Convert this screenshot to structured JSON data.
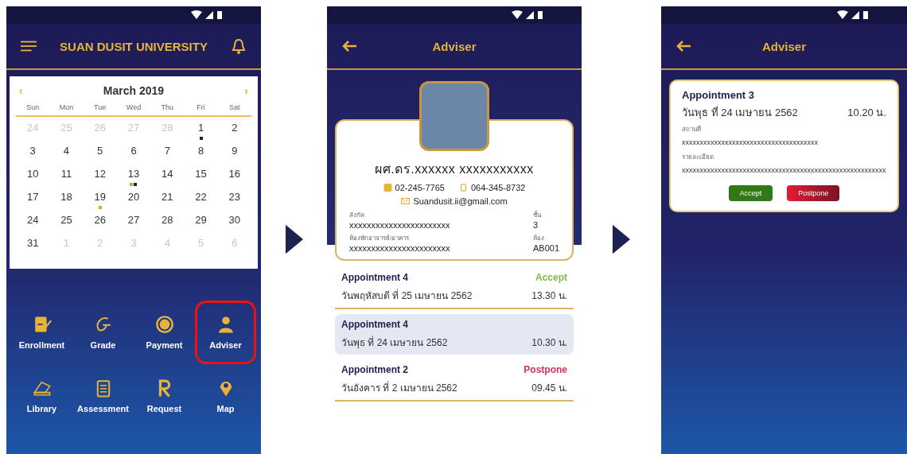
{
  "home": {
    "title": "SUAN DUSIT UNIVERSITY",
    "calendar": {
      "prev": "‹",
      "month": "March 2019",
      "next": "›",
      "weekdays": [
        "Sun",
        "Mon",
        "Tue",
        "Wed",
        "Thu",
        "Fri",
        "Sat"
      ],
      "days": [
        {
          "label": "24",
          "muted": true
        },
        {
          "label": "25",
          "muted": true
        },
        {
          "label": "26",
          "muted": true
        },
        {
          "label": "27",
          "muted": true
        },
        {
          "label": "28",
          "muted": true
        },
        {
          "label": "1",
          "muted": false,
          "dots": [
            {
              "color": "#1c1d54"
            }
          ]
        },
        {
          "label": "2",
          "muted": false
        },
        {
          "label": "3",
          "muted": false
        },
        {
          "label": "4",
          "muted": false
        },
        {
          "label": "5",
          "muted": false
        },
        {
          "label": "6",
          "muted": false
        },
        {
          "label": "7",
          "muted": false
        },
        {
          "label": "8",
          "muted": false
        },
        {
          "label": "9",
          "muted": false
        },
        {
          "label": "10",
          "muted": false
        },
        {
          "label": "11",
          "muted": false
        },
        {
          "label": "12",
          "muted": false
        },
        {
          "label": "13",
          "muted": false,
          "dots": [
            {
              "color": "#e0a030"
            },
            {
              "color": "#1c1d54"
            }
          ]
        },
        {
          "label": "14",
          "muted": false
        },
        {
          "label": "15",
          "muted": false
        },
        {
          "label": "16",
          "muted": false
        },
        {
          "label": "17",
          "muted": false
        },
        {
          "label": "18",
          "muted": false
        },
        {
          "label": "19",
          "muted": false,
          "dots": [
            {
              "color": "#e0a030"
            }
          ]
        },
        {
          "label": "20",
          "muted": false
        },
        {
          "label": "21",
          "muted": false
        },
        {
          "label": "22",
          "muted": false
        },
        {
          "label": "23",
          "muted": false
        },
        {
          "label": "24",
          "muted": false
        },
        {
          "label": "25",
          "muted": false
        },
        {
          "label": "26",
          "muted": false
        },
        {
          "label": "27",
          "muted": false
        },
        {
          "label": "28",
          "muted": false
        },
        {
          "label": "29",
          "muted": false
        },
        {
          "label": "30",
          "muted": false
        },
        {
          "label": "31",
          "muted": false
        },
        {
          "label": "1",
          "muted": true
        },
        {
          "label": "2",
          "muted": true
        },
        {
          "label": "3",
          "muted": true
        },
        {
          "label": "4",
          "muted": true
        },
        {
          "label": "5",
          "muted": true
        },
        {
          "label": "6",
          "muted": true
        }
      ]
    },
    "menu": [
      {
        "label": "Enrollment",
        "selected": false
      },
      {
        "label": "Grade",
        "selected": false
      },
      {
        "label": "Payment",
        "selected": false
      },
      {
        "label": "Adviser",
        "selected": true
      },
      {
        "label": "Library",
        "selected": false
      },
      {
        "label": "Assessment",
        "selected": false
      },
      {
        "label": "Request",
        "selected": false
      },
      {
        "label": "Map",
        "selected": false
      }
    ]
  },
  "adviser": {
    "title": "Adviser",
    "name": "ผศ.ดร.xxxxxx  xxxxxxxxxxx",
    "phone": "02-245-7765",
    "mobile": "064-345-8732",
    "email": "Suandusit.ii@gmail.com",
    "info": [
      {
        "label": "สังกัด",
        "value": "xxxxxxxxxxxxxxxxxxxxxxx"
      },
      {
        "label": "ชั้น",
        "value": "3"
      },
      {
        "label": "ห้องพักอาจารย์/อาคาร",
        "value": "xxxxxxxxxxxxxxxxxxxxxxx"
      },
      {
        "label": "ห้อง",
        "value": "AB001"
      }
    ],
    "appointments": [
      {
        "title": "Appointment 4",
        "status": "Accept",
        "color": "#7dbb42",
        "date": "วันพฤหัสบดี ที่ 25 เมษายน 2562",
        "time": "13.30 น.",
        "selected": false
      },
      {
        "title": "Appointment 4",
        "date": "วันพุธ ที่ 24 เมษายน 2562",
        "time": "10.30 น.",
        "selected": true
      },
      {
        "title": "Appointment 2",
        "status": "Postpone",
        "color": "#d6335a",
        "date": "วันอังคาร ที่ 2 เมษายน 2562",
        "time": "09.45 น.",
        "selected": false
      }
    ]
  },
  "detail": {
    "title": "Adviser",
    "appointment": "Appointment 3",
    "date": "วันพุธ ที่ 24 เมษายน 2562",
    "time": "10.20 น.",
    "place_label": "สถานที่",
    "place": "xxxxxxxxxxxxxxxxxxxxxxxxxxxxxxxxxxxxxx",
    "details_label": "รายละเอียด",
    "details": "xxxxxxxxxxxxxxxxxxxxxxxxxxxxxxxxxxxxxxxxxxxxxxxxxxxxxxxxx",
    "buttons": [
      {
        "label": "Accept",
        "kind": "accept"
      },
      {
        "label": "Postpone",
        "kind": "postpone"
      }
    ]
  }
}
